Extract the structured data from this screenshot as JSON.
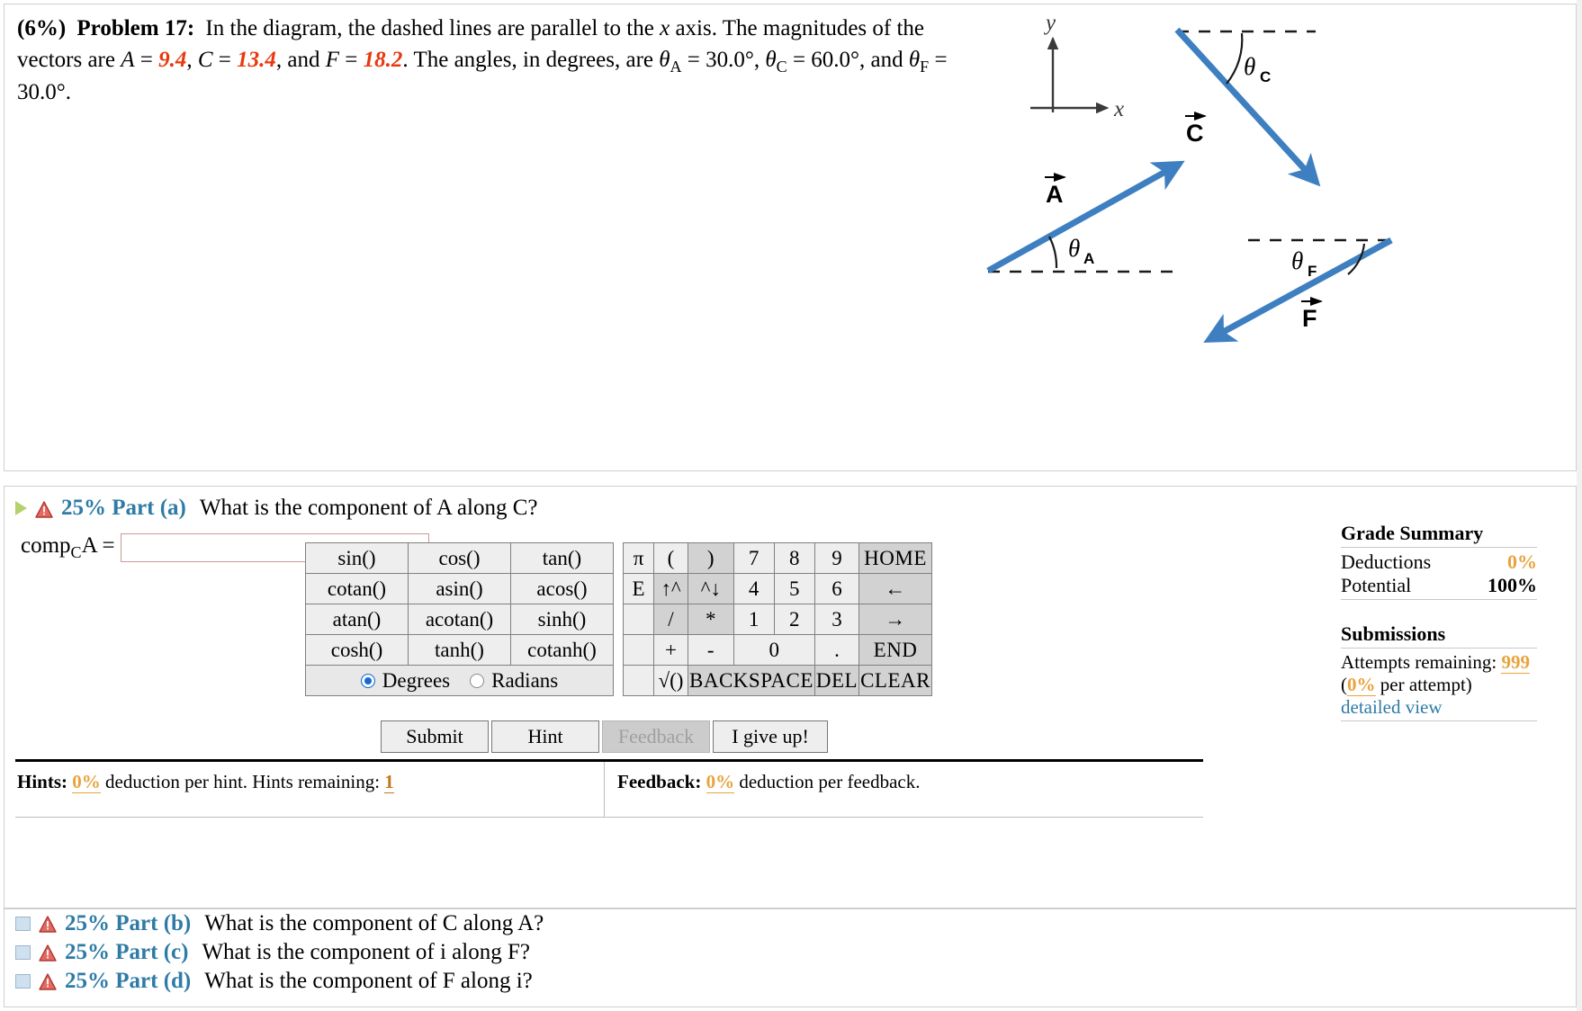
{
  "problem": {
    "weight": "(6%)",
    "label": "Problem 17:",
    "line1_a": "In the diagram, the dashed lines are parallel to the ",
    "x_italic": "x",
    "line1_b": " axis. The magnitudes of the",
    "line2_a": "vectors are ",
    "A_sym": "A",
    "eq1": " = ",
    "A_val": "9.4",
    "c1": ", ",
    "C_sym": "C",
    "eq2": " = ",
    "C_val": "13.4",
    "c2": ", and ",
    "F_sym": "F",
    "eq3": " = ",
    "F_val": "18.2",
    "line2_b": ". The angles, in degrees, are ",
    "theta": "θ",
    "sub_A": "A",
    "angA": " = 30.0°, ",
    "sub_C": "C",
    "angC": " = 60.0°, and ",
    "sub_F": "F",
    "angF": " =",
    "line3": "30.0°."
  },
  "figure": {
    "axis_y_label": "y",
    "axis_x_label": "x",
    "vector_A_label": "A",
    "vector_C_label": "C",
    "vector_F_label": "F",
    "angle_A_label": "θ",
    "angle_A_sub": "A",
    "angle_C_label": "θ",
    "angle_C_sub": "C",
    "angle_F_label": "θ",
    "angle_F_sub": "F",
    "vector_color": "#3d7fc1",
    "axis_color": "#3a3a3a"
  },
  "part_a": {
    "percent": "25% Part (a)",
    "question": "What is the component of A along C?",
    "answer_label_pre": "comp",
    "answer_label_sub": "C",
    "answer_label_post": "A =",
    "answer_value": "",
    "answer_placeholder": ""
  },
  "keypad": {
    "functions": [
      [
        "sin()",
        "cos()",
        "tan()"
      ],
      [
        "cotan()",
        "asin()",
        "acos()"
      ],
      [
        "atan()",
        "acotan()",
        "sinh()"
      ],
      [
        "cosh()",
        "tanh()",
        "cotanh()"
      ]
    ],
    "mode_degrees": "Degrees",
    "mode_radians": "Radians",
    "mode_selected": "Degrees",
    "const_col": [
      "π",
      "E",
      "",
      "",
      ""
    ],
    "op_rows": [
      [
        "(",
        ")",
        "7",
        "8",
        "9",
        "HOME"
      ],
      [
        "↑^",
        "^↓",
        "4",
        "5",
        "6",
        "←"
      ],
      [
        "/",
        "*",
        "1",
        "2",
        "3",
        "→"
      ],
      [
        "+",
        "-",
        "0",
        ".",
        "END"
      ],
      [
        "√()",
        "BACKSPACE",
        "DEL",
        "CLEAR"
      ]
    ]
  },
  "actions": {
    "submit": "Submit",
    "hint": "Hint",
    "feedback": "Feedback",
    "giveup": "I give up!"
  },
  "hints_bar": {
    "hints_label": "Hints:",
    "hints_pct": "0%",
    "hints_mid": "deduction per hint. Hints remaining:",
    "hints_remaining": "1",
    "feedback_label": "Feedback:",
    "feedback_pct": "0%",
    "feedback_mid": "deduction per feedback."
  },
  "grade": {
    "title": "Grade Summary",
    "deductions_label": "Deductions",
    "deductions_value": "0%",
    "potential_label": "Potential",
    "potential_value": "100%",
    "submissions_title": "Submissions",
    "attempts_label": "Attempts remaining:",
    "attempts_value": "999",
    "per_attempt_pct": "0%",
    "per_attempt_rest": " per attempt)",
    "per_attempt_open": "(",
    "detailed_view": "detailed view"
  },
  "other_parts": [
    {
      "percent": "25% Part (b)",
      "question": "What is the component of C along A?"
    },
    {
      "percent": "25% Part (c)",
      "question": "What is the component of i along F?"
    },
    {
      "percent": "25% Part (d)",
      "question": "What is the component of F along i?"
    }
  ]
}
